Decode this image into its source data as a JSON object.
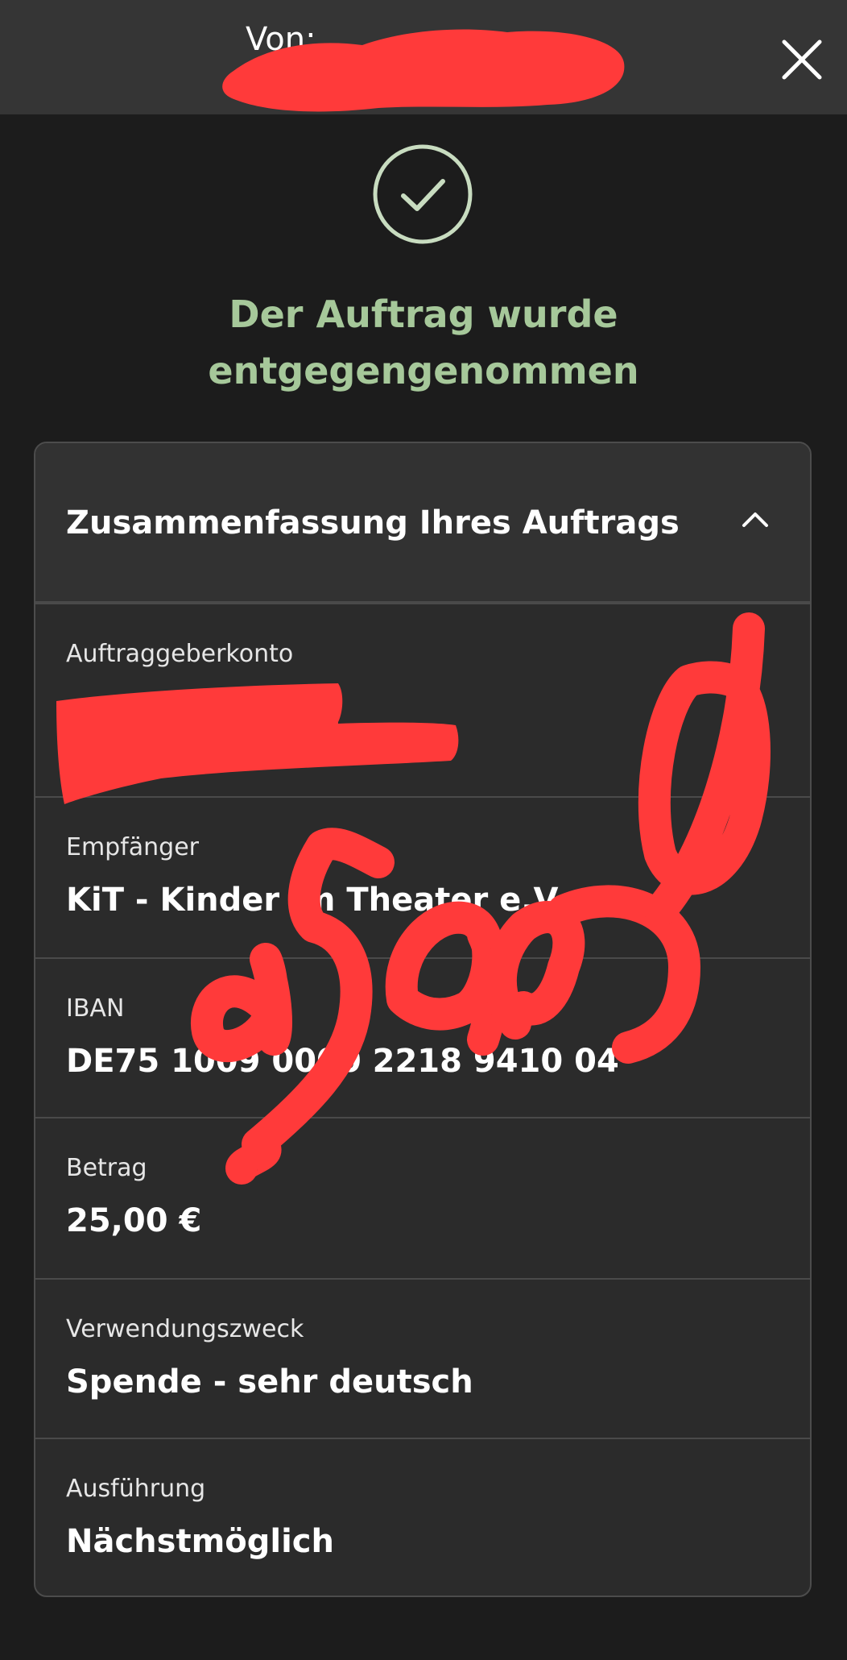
{
  "header": {
    "from_label": "Von:",
    "close_icon": "close-icon"
  },
  "status": {
    "icon": "check-circle-icon",
    "headline_line1": "Der Auftrag wurde",
    "headline_line2": "entgegengenommen",
    "color": "#a6c89a"
  },
  "summary": {
    "title": "Zusammenfassung Ihres Auftrags",
    "toggle_icon": "chevron-up-icon",
    "rows": [
      {
        "label": "Auftraggeberkonto",
        "value": ""
      },
      {
        "label": "Empfänger",
        "value": "KiT - Kinder im Theater e.V."
      },
      {
        "label": "IBAN",
        "value": "DE75 1009 0000 2218 9410 04"
      },
      {
        "label": "Betrag",
        "value": "25,00 €"
      },
      {
        "label": "Verwendungszweck",
        "value": "Spende - sehr deutsch"
      },
      {
        "label": "Ausführung",
        "value": "Nächstmöglich"
      }
    ]
  },
  "overlay": {
    "redaction_color": "#ff3a3a",
    "handwritten_text": "9599 0"
  }
}
